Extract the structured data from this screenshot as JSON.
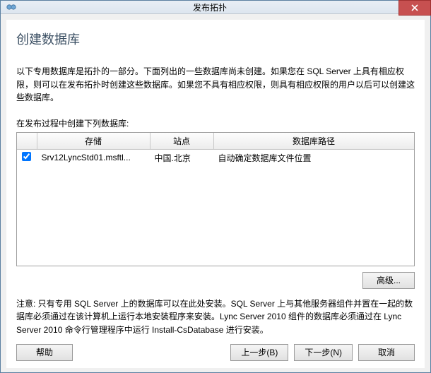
{
  "window": {
    "title": "发布拓扑"
  },
  "heading": "创建数据库",
  "desc": "以下专用数据库是拓扑的一部分。下面列出的一些数据库尚未创建。如果您在 SQL Server 上具有相应权限，则可以在发布拓扑时创建这些数据库。如果您不具有相应权限，则具有相应权限的用户以后可以创建这些数据库。",
  "subheading": "在发布过程中创建下列数据库:",
  "columns": {
    "store": "存储",
    "site": "站点",
    "path": "数据库路径"
  },
  "rows": [
    {
      "checked": true,
      "store": "Srv12LyncStd01.msftl...",
      "site": "中国.北京",
      "path": "自动确定数据库文件位置"
    }
  ],
  "buttons": {
    "advanced": "高级...",
    "help": "帮助",
    "back": "上一步(B)",
    "next": "下一步(N)",
    "cancel": "取消"
  },
  "note": "注意: 只有专用 SQL Server 上的数据库可以在此处安装。SQL Server 上与其他服务器组件并置在一起的数据库必须通过在该计算机上运行本地安装程序来安装。Lync Server 2010 组件的数据库必须通过在 Lync Server 2010 命令行管理程序中运行 Install-CsDatabase 进行安装。"
}
